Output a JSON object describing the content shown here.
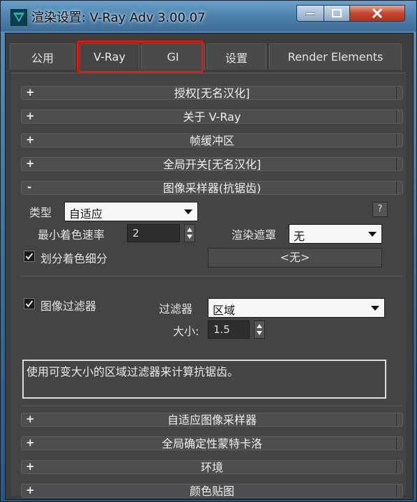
{
  "window": {
    "title": "渲染设置: V-Ray Adv 3.00.07",
    "icon": "3dsmax-app-icon",
    "controls": [
      "minimize-icon",
      "maximize-icon",
      "close-icon"
    ]
  },
  "tabs": [
    {
      "label": "公用"
    },
    {
      "label": "V-Ray"
    },
    {
      "label": "GI"
    },
    {
      "label": "设置"
    },
    {
      "label": "Render Elements"
    }
  ],
  "rollouts_top": [
    {
      "sign": "+",
      "title": "授权[无名汉化]"
    },
    {
      "sign": "+",
      "title": "关于 V-Ray"
    },
    {
      "sign": "+",
      "title": "帧缓冲区"
    },
    {
      "sign": "+",
      "title": "全局开关[无名汉化]"
    }
  ],
  "image_sampler": {
    "sign": "-",
    "title": "图像采样器(抗锯齿)",
    "type_label": "类型",
    "type_value": "自适应",
    "help_label": "?",
    "min_rate_label": "最小着色速率",
    "min_rate_value": "2",
    "render_mask_label": "渲染遮罩",
    "render_mask_value": "无",
    "subdivide_label": "划分着色细分",
    "mask_button_label": "<无>"
  },
  "image_filter": {
    "label": "图像过滤器",
    "filter_label": "过滤器",
    "filter_value": "区域",
    "size_label": "大小:",
    "size_value": "1.5",
    "description": "使用可变大小的区域过滤器来计算抗锯齿。"
  },
  "rollouts_bottom": [
    {
      "sign": "+",
      "title": "自适应图像采样器"
    },
    {
      "sign": "+",
      "title": "全局确定性蒙特卡洛"
    },
    {
      "sign": "+",
      "title": "环境"
    },
    {
      "sign": "+",
      "title": "颜色贴图"
    }
  ],
  "colors": {
    "highlight": "#e8140c",
    "panel": "#444444",
    "titlebar": "#4c7fa9"
  }
}
